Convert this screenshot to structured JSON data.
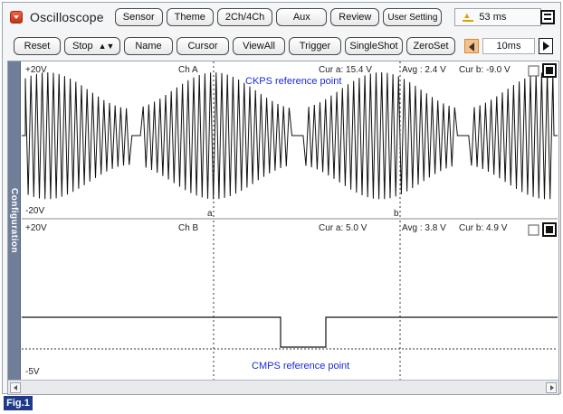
{
  "app": {
    "title": "Oscilloscope",
    "icon": "app-menu-icon"
  },
  "toolbar_top": {
    "buttons": [
      "Sensor",
      "Theme",
      "2Ch/4Ch",
      "Aux",
      "Review",
      "User Setting"
    ],
    "refresh_readout": "53 ms"
  },
  "toolbar_bottom": {
    "buttons": [
      "Reset",
      "Stop",
      "Name",
      "Cursor",
      "ViewAll",
      "Trigger",
      "SingleShot",
      "ZeroSet"
    ],
    "timebase": "10ms"
  },
  "side_tab": "Configuration",
  "channel_a": {
    "max_label": "+20V",
    "min_label": "-20V",
    "name": "Ch A",
    "cur_a": "Cur a: 15.4 V",
    "avg": "Avg : 2.4 V",
    "cur_b": "Cur b: -9.0 V",
    "annotation": "CKPS reference point",
    "cursor_a_label": "a",
    "cursor_b_label": "b"
  },
  "channel_b": {
    "max_label": "+20V",
    "min_label": "-5V",
    "name": "Ch B",
    "cur_a": "Cur a: 5.0 V",
    "avg": "Avg : 3.8 V",
    "cur_b": "Cur b: 4.9 V",
    "annotation": "CMPS reference point"
  },
  "figure_label": "Fig.1",
  "colors": {
    "signal": "#111111",
    "annotation": "#1a2ad8",
    "side_tab": "#6f7f9a",
    "figure_label_bg": "#1f3a8a"
  }
}
